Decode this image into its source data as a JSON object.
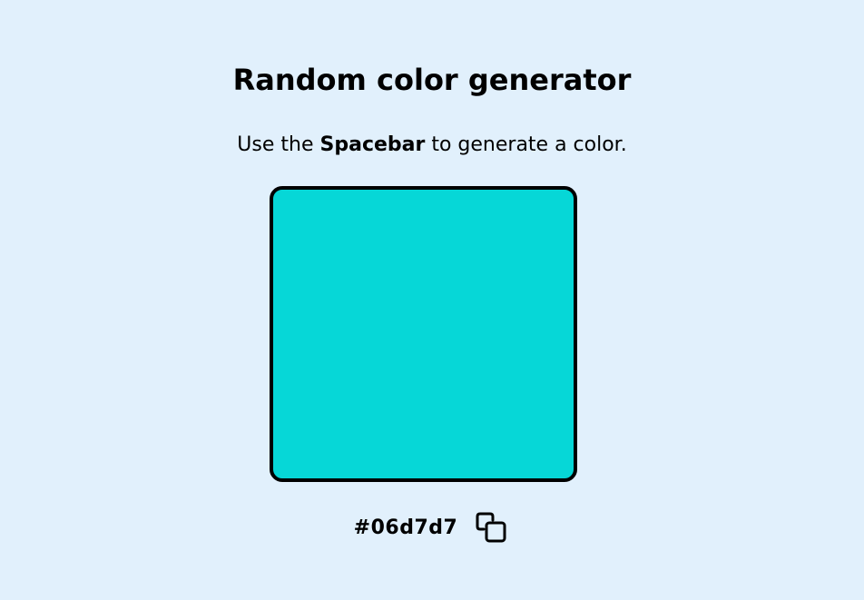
{
  "page": {
    "title": "Random color generator",
    "instructions_before": "Use the ",
    "instructions_key": "Spacebar",
    "instructions_after": " to generate a color."
  },
  "color": {
    "hex": "#06d7d7"
  },
  "copy_button": {
    "icon": "copy-icon"
  },
  "colors": {
    "background": "#e1f0fc",
    "swatch": "#06d7d7",
    "border": "#000000"
  }
}
